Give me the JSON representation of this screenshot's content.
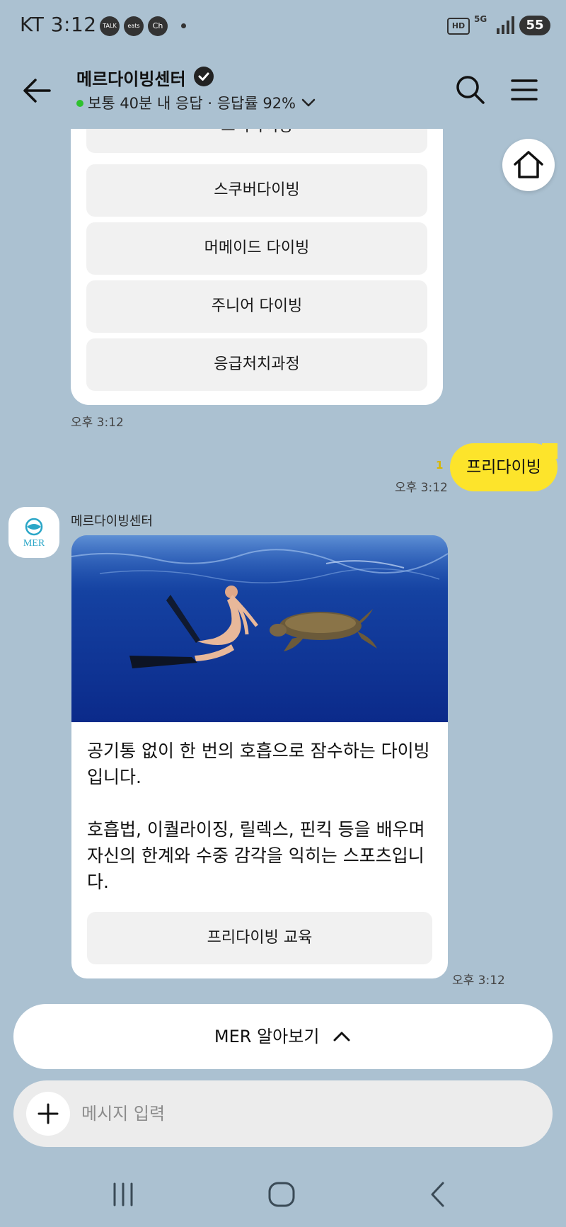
{
  "status_bar": {
    "carrier_time": "KT 3:12",
    "notif_icons": [
      "TALK",
      "eats",
      "Ch"
    ],
    "hd": "HD",
    "network": "5G",
    "battery": "55"
  },
  "header": {
    "title": "메르다이빙센터",
    "response_info": "보통 40분 내 응답 · 응답률 92%"
  },
  "menu_card": {
    "options": [
      "프리다이빙",
      "스쿠버다이빙",
      "머메이드 다이빙",
      "주니어 다이빙",
      "응급처치과정"
    ],
    "time": "오후 3:12"
  },
  "my_message": {
    "text": "프리다이빙",
    "unread": "1",
    "time": "오후 3:12"
  },
  "bot_message": {
    "sender": "메르다이빙센터",
    "avatar_text": "MER",
    "description_1": "공기통 없이 한 번의 호흡으로 잠수하는 다이빙입니다.",
    "description_2": "호흡법, 이퀄라이징, 릴렉스, 핀킥 등을 배우며 자신의 한계와 수중 감각을 익히는 스포츠입니다.",
    "cta": "프리다이빙 교육",
    "time": "오후 3:12"
  },
  "bottom": {
    "menu_label": "MER 알아보기",
    "input_placeholder": "메시지 입력"
  },
  "colors": {
    "background": "#abc1d1",
    "my_bubble": "#fde42b",
    "online": "#2ec12e"
  }
}
